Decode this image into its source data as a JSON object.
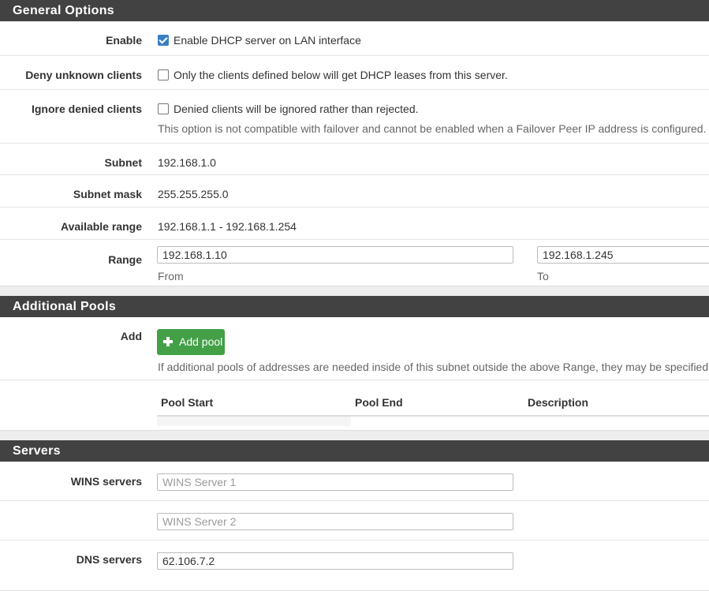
{
  "general": {
    "heading": "General Options",
    "enable": {
      "label": "Enable",
      "text": "Enable DHCP server on LAN interface"
    },
    "deny": {
      "label": "Deny unknown clients",
      "text": "Only the clients defined below will get DHCP leases from this server."
    },
    "ignore": {
      "label": "Ignore denied clients",
      "text": "Denied clients will be ignored rather than rejected.",
      "help": "This option is not compatible with failover and cannot be enabled when a Failover Peer IP address is configured."
    },
    "subnet": {
      "label": "Subnet",
      "value": "192.168.1.0"
    },
    "subnet_mask": {
      "label": "Subnet mask",
      "value": "255.255.255.0"
    },
    "available_range": {
      "label": "Available range",
      "value": "192.168.1.1 - 192.168.1.254"
    },
    "range": {
      "label": "Range",
      "from_value": "192.168.1.10",
      "from_label": "From",
      "to_value": "192.168.1.245",
      "to_label": "To"
    }
  },
  "pools": {
    "heading": "Additional Pools",
    "add_label": "Add",
    "add_button": "Add pool",
    "help": "If additional pools of addresses are needed inside of this subnet outside the above Range, they may be specified he",
    "columns": [
      "Pool Start",
      "Pool End",
      "Description"
    ]
  },
  "servers": {
    "heading": "Servers",
    "wins_label": "WINS servers",
    "wins1_placeholder": "WINS Server 1",
    "wins2_placeholder": "WINS Server 2",
    "dns_label": "DNS servers",
    "dns1_value": "62.106.7.2"
  }
}
